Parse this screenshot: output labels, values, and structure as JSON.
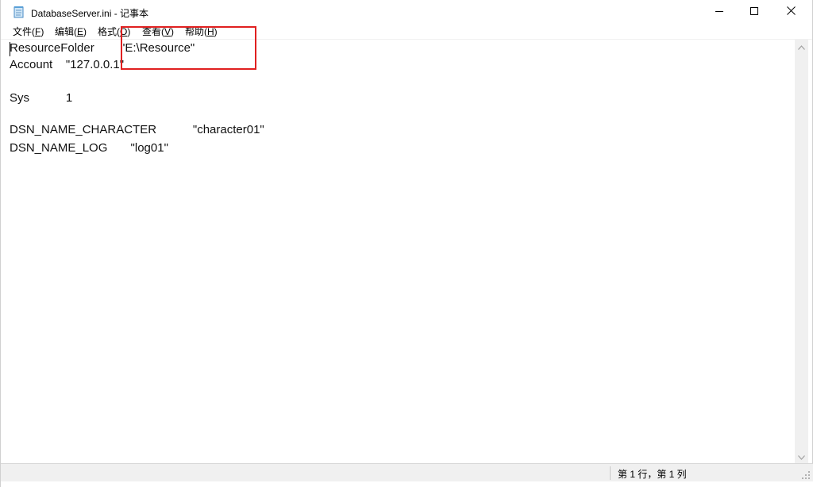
{
  "window": {
    "title": "DatabaseServer.ini - 记事本"
  },
  "menu": [
    {
      "label": "文件(",
      "mnemonic": "F",
      "close": ")"
    },
    {
      "label": "编辑(",
      "mnemonic": "E",
      "close": ")"
    },
    {
      "label": "格式(",
      "mnemonic": "O",
      "close": ")"
    },
    {
      "label": "查看(",
      "mnemonic": "V",
      "close": ")"
    },
    {
      "label": "帮助(",
      "mnemonic": "H",
      "close": ")"
    }
  ],
  "document": {
    "lines": [
      "ResourceFolder        \"E:\\Resource\"",
      "Account    \"127.0.0.1\"",
      "",
      "Sys           1",
      "",
      "DSN_NAME_CHARACTER           \"character01\"",
      "DSN_NAME_LOG       \"log01\""
    ]
  },
  "status": {
    "position": "第 1 行，第 1 列"
  },
  "colors": {
    "highlight": "#e02020",
    "statusbar_bg": "#f0f0f0"
  },
  "icons": {
    "app": "notepad-icon",
    "minimize": "minimize-icon",
    "maximize": "maximize-icon",
    "close": "close-icon"
  }
}
